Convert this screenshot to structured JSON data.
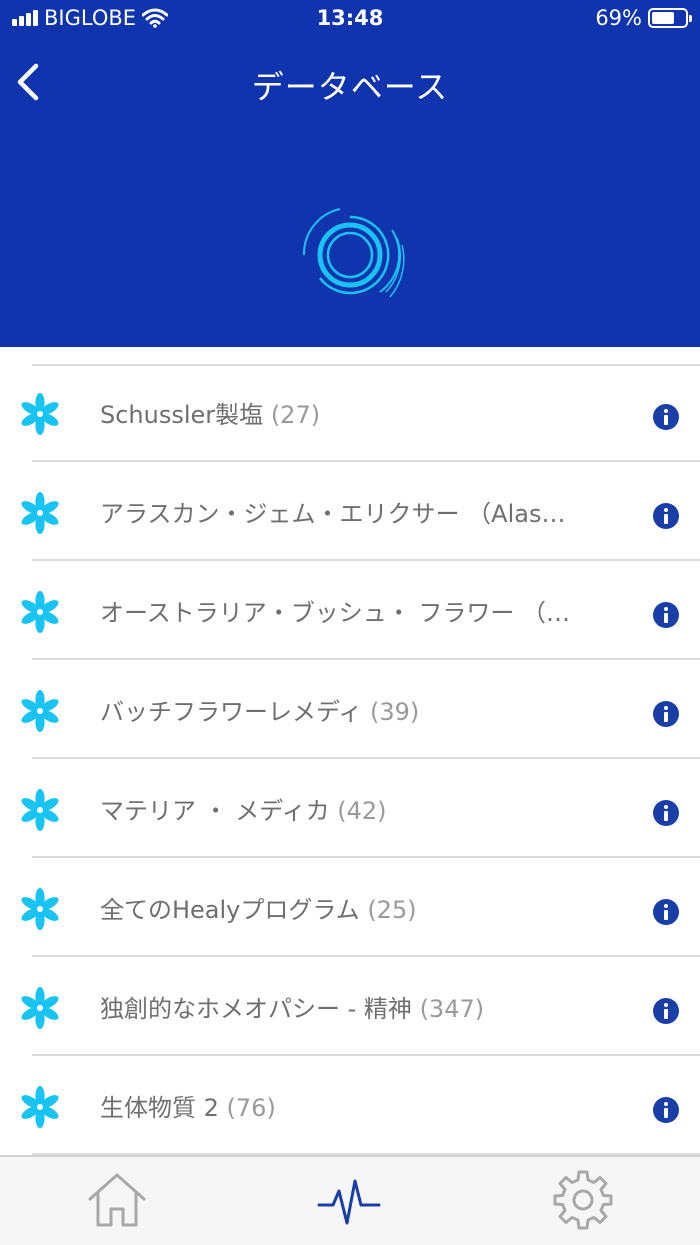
{
  "status_bar": {
    "carrier": "BIGLOBE",
    "time": "13:48",
    "battery_percent": "69%",
    "battery_level": 0.69,
    "icons": [
      "signal-icon",
      "wifi-icon",
      "battery-icon"
    ]
  },
  "nav": {
    "title": "データベース",
    "back_icon": "chevron-left-icon"
  },
  "colors": {
    "header_bg": "#0f34ad",
    "accent_cyan": "#19c4f2",
    "info_blue": "#1a3ea8",
    "text_gray": "#6f6f6f",
    "count_gray": "#9a9a9a"
  },
  "items": [
    {
      "label": "Schussler製塩",
      "count": "(27)"
    },
    {
      "label": "アラスカン・ジェム・エリクサー （Alas…",
      "count": ""
    },
    {
      "label": "オーストラリア・ブッシュ・ フラワー （…",
      "count": ""
    },
    {
      "label": "バッチフラワーレメディ",
      "count": "(39)"
    },
    {
      "label": "マテリア ・ メディカ",
      "count": "(42)"
    },
    {
      "label": "全てのHealyプログラム",
      "count": "(25)"
    },
    {
      "label": "独創的なホメオパシー - 精神",
      "count": "(347)"
    },
    {
      "label": "生体物質 2",
      "count": "(76)"
    }
  ],
  "tab_bar": {
    "tabs": [
      "home-icon",
      "pulse-icon",
      "gear-icon"
    ],
    "active": "pulse-icon"
  }
}
